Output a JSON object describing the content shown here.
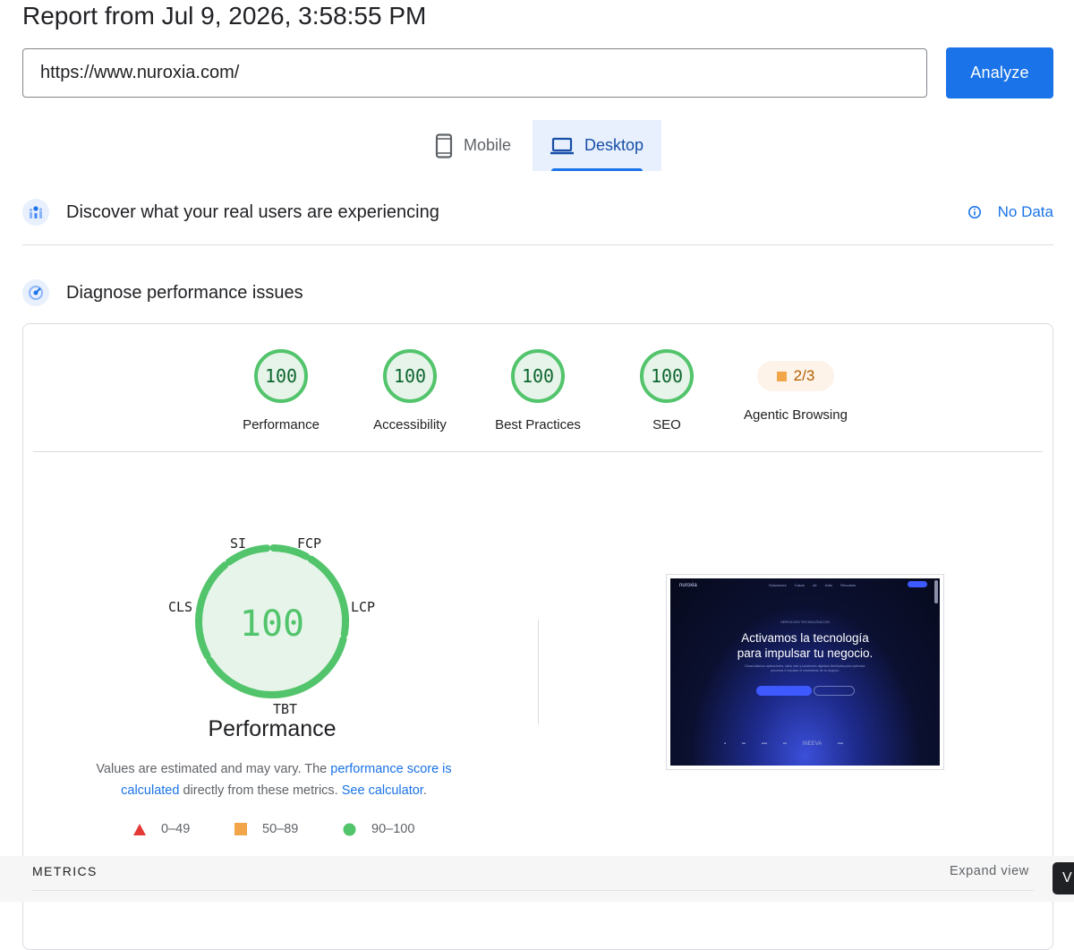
{
  "header": {
    "report_title": "Report from Jul 9, 2026, 3:58:55 PM"
  },
  "url_input": {
    "value": "https://www.nuroxia.com/",
    "placeholder": ""
  },
  "analyze_label": "Analyze",
  "device_tabs": [
    {
      "label": "Mobile",
      "icon": "phone-icon",
      "selected": false
    },
    {
      "label": "Desktop",
      "icon": "laptop-icon",
      "selected": true
    }
  ],
  "field_data": {
    "title": "Discover what your real users are experiencing",
    "status": "No Data",
    "icon": "users-chart-icon"
  },
  "diagnose": {
    "title": "Diagnose performance issues",
    "icon": "gauge-icon"
  },
  "scores": [
    {
      "label": "Performance",
      "value": "100"
    },
    {
      "label": "Accessibility",
      "value": "100"
    },
    {
      "label": "Best Practices",
      "value": "100"
    },
    {
      "label": "SEO",
      "value": "100"
    }
  ],
  "agentic": {
    "label": "Agentic Browsing",
    "value": "2/3"
  },
  "performance_gauge": {
    "score": "100",
    "title": "Performance",
    "metric_labels": {
      "si": "SI",
      "fcp": "FCP",
      "lcp": "LCP",
      "tbt": "TBT",
      "cls": "CLS"
    },
    "note_prefix": "Values are estimated and may vary. The ",
    "note_link1": "performance score is calculated",
    "note_mid": " directly from these metrics. ",
    "note_link2": "See calculator",
    "note_suffix": "."
  },
  "legend": [
    {
      "range": "0–49",
      "shape": "triangle",
      "color": "#e53935"
    },
    {
      "range": "50–89",
      "shape": "square",
      "color": "#f2a649"
    },
    {
      "range": "90–100",
      "shape": "circle",
      "color": "#52c46b"
    }
  ],
  "screenshot_thumb": {
    "logo": "nuroxia",
    "nav": "Soluciones Casos de éxito Recursos",
    "kicker": "SERVICIOS TECNOLÓGICOS",
    "headline_1": "Activamos la tecnología",
    "headline_2": "para impulsar tu negocio.",
    "sub": "Desarrollamos aplicaciones, sitios web y soluciones digitales diseñadas para optimizar procesos e impulsar el crecimiento de tu negocio.",
    "brands": "▪ ▪▪ ▪▪▪ ▪▪ INEEVA ▪▪▪"
  },
  "metrics": {
    "label": "METRICS",
    "expand_label": "Expand view"
  },
  "corner_badge": "V",
  "colors": {
    "accent": "#1a73e8",
    "pass": "#52c46b",
    "average": "#f2a649",
    "fail": "#e53935"
  }
}
